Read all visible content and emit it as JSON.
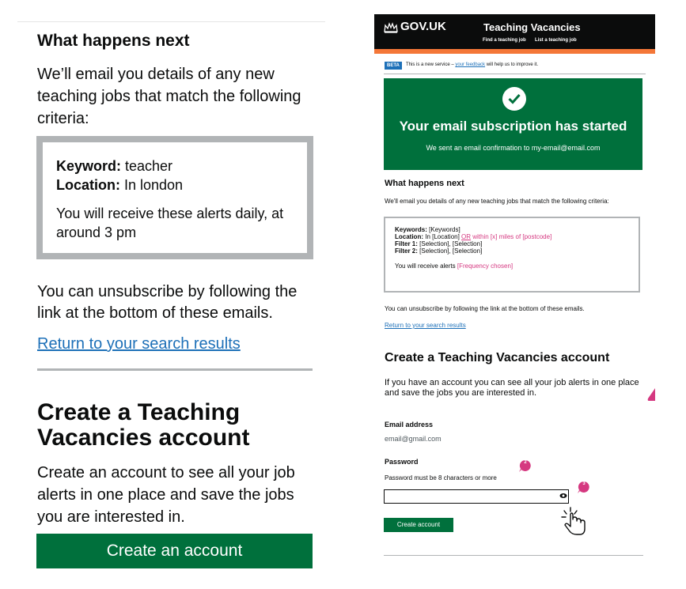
{
  "left": {
    "heading": "What happens next",
    "intro": "We’ll email you details of any new teaching jobs that match the following criteria:",
    "criteria": {
      "keyword_label": "Keyword:",
      "keyword_value": " teacher",
      "location_label": "Location:",
      "location_value": " In london",
      "frequency": "You will receive these alerts daily, at around 3 pm"
    },
    "unsubscribe": "You can unsubscribe by following the link at the bottom of these emails.",
    "return_link": "Return to your search results",
    "create_heading": "Create a Teaching Vacancies account",
    "create_description": "Create an account to see all your job alerts in one place and save the jobs you are interested in.",
    "create_button": "Create an account"
  },
  "right": {
    "header": {
      "logo": "GOV.UK",
      "service": "Teaching Vacancies",
      "nav": [
        "Find a teaching job",
        "List a teaching job"
      ]
    },
    "beta": {
      "tag": "BETA",
      "text_before": "This is a new service – ",
      "link": "your feedback",
      "text_after": " will help us to improve it."
    },
    "panel": {
      "title": "Your email subscription has started",
      "body": "We sent an email confirmation to my-email@email.com"
    },
    "heading": "What happens next",
    "intro": "We'll email you details of any new teaching jobs that match the following criteria:",
    "criteria": {
      "keywords_label": "Keywords:",
      "keywords_value": " [Keywords]",
      "location_label": "Location:",
      "location_value": " In [Location] ",
      "location_or": "OR",
      "location_within": " within [x] miles of [postcode]",
      "filter1_label": "Filter 1:",
      "filter1_value": " [Selection], [Selection]",
      "filter2_label": "Filter 2:",
      "filter2_value": " [Selection], [Selection]",
      "alerts_text": "You will receive alerts ",
      "alerts_value": "[Frequency chosen]"
    },
    "unsubscribe": "You can unsubscribe by following the link at the bottom of these emails.",
    "return_link": "Return to your search results",
    "create_heading": "Create a Teaching Vacancies account",
    "create_description": "If you have an account you can see all your job alerts in one place and save the jobs you are interested in.",
    "email_label": "Email address",
    "email_value": "email@gmail.com",
    "password_label": "Password",
    "password_hint": "Password must be 8 characters or more",
    "password_value": "",
    "create_button": "Create account",
    "markers": [
      "2",
      "3"
    ]
  },
  "colors": {
    "govuk_green": "#00703c",
    "govuk_black": "#0b0c0c",
    "govuk_blue": "#1d70b8",
    "govuk_orange": "#f47738",
    "annotation_pink": "#d53880",
    "border_grey": "#b1b4b6"
  },
  "icons": [
    "crown-icon",
    "check-icon",
    "eye-icon",
    "hand-cursor-icon",
    "annotation-marker-icon"
  ]
}
